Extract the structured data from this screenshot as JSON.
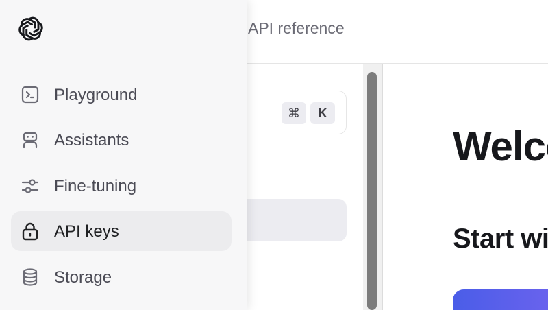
{
  "header": {
    "nav_link": "API reference"
  },
  "search": {
    "shortcut_cmd": "⌘",
    "shortcut_key": "K"
  },
  "content": {
    "heading": "Welcome",
    "subheading": "Start with the basics"
  },
  "sidebar": {
    "items": [
      {
        "label": "Playground",
        "icon": "terminal-icon"
      },
      {
        "label": "Assistants",
        "icon": "robot-icon"
      },
      {
        "label": "Fine-tuning",
        "icon": "sliders-icon"
      },
      {
        "label": "API keys",
        "icon": "lock-icon",
        "active": true
      },
      {
        "label": "Storage",
        "icon": "database-icon"
      }
    ]
  },
  "colors": {
    "sidebar_bg": "#f7f7f8",
    "active_item_bg": "#ececee",
    "cta_gradient_start": "#4a5de8",
    "cta_gradient_end": "#6d63ee"
  }
}
